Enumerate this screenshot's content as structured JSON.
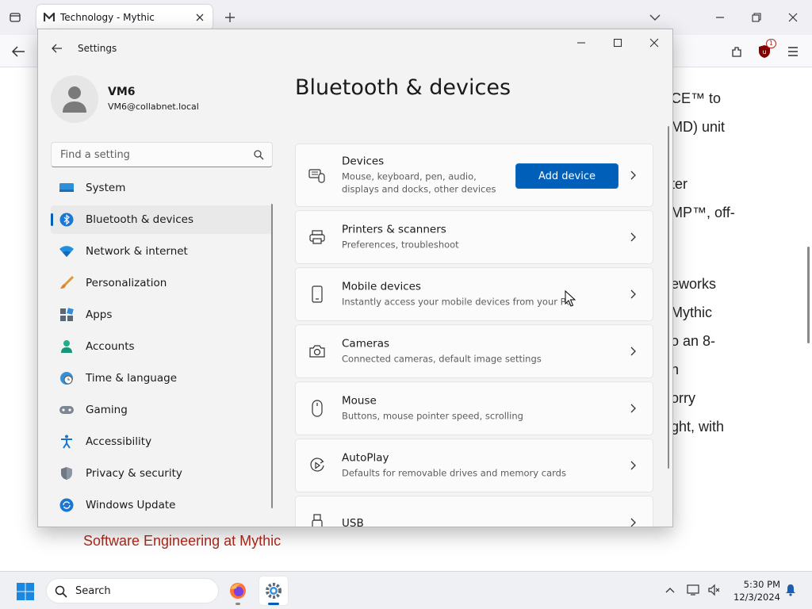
{
  "browser": {
    "tab": {
      "title": "Technology - Mythic"
    }
  },
  "webpage": {
    "text_lines": [
      "CE™ to",
      "MD) unit",
      "ter",
      "MP™, off-",
      "eworks",
      "Mythic",
      "o an 8-",
      "h",
      "orry",
      "ght, with"
    ],
    "link": "Software Engineering at Mythic"
  },
  "settings": {
    "window_title": "Settings",
    "user": {
      "name": "VM6",
      "email": "VM6@collabnet.local"
    },
    "search": {
      "placeholder": "Find a setting"
    },
    "nav": [
      {
        "label": "System",
        "icon": "monitor-icon"
      },
      {
        "label": "Bluetooth & devices",
        "icon": "bluetooth-icon",
        "active": true
      },
      {
        "label": "Network & internet",
        "icon": "wifi-icon"
      },
      {
        "label": "Personalization",
        "icon": "paintbrush-icon"
      },
      {
        "label": "Apps",
        "icon": "apps-icon"
      },
      {
        "label": "Accounts",
        "icon": "person-icon"
      },
      {
        "label": "Time & language",
        "icon": "globe-clock-icon"
      },
      {
        "label": "Gaming",
        "icon": "gamepad-icon"
      },
      {
        "label": "Accessibility",
        "icon": "accessibility-icon"
      },
      {
        "label": "Privacy & security",
        "icon": "shield-icon"
      },
      {
        "label": "Windows Update",
        "icon": "update-icon"
      }
    ],
    "page_title": "Bluetooth & devices",
    "cards": [
      {
        "title": "Devices",
        "subtitle": "Mouse, keyboard, pen, audio, displays and docks, other devices",
        "icon": "devices-icon",
        "button": "Add device"
      },
      {
        "title": "Printers & scanners",
        "subtitle": "Preferences, troubleshoot",
        "icon": "printer-icon"
      },
      {
        "title": "Mobile devices",
        "subtitle": "Instantly access your mobile devices from your PC",
        "icon": "phone-icon"
      },
      {
        "title": "Cameras",
        "subtitle": "Connected cameras, default image settings",
        "icon": "camera-icon"
      },
      {
        "title": "Mouse",
        "subtitle": "Buttons, mouse pointer speed, scrolling",
        "icon": "mouse-icon"
      },
      {
        "title": "AutoPlay",
        "subtitle": "Defaults for removable drives and memory cards",
        "icon": "autoplay-icon"
      },
      {
        "title": "USB",
        "subtitle": "",
        "icon": "usb-icon"
      }
    ]
  },
  "taskbar": {
    "search_label": "Search",
    "time": "5:30 PM",
    "date": "12/3/2024"
  },
  "extension_badge": "1"
}
